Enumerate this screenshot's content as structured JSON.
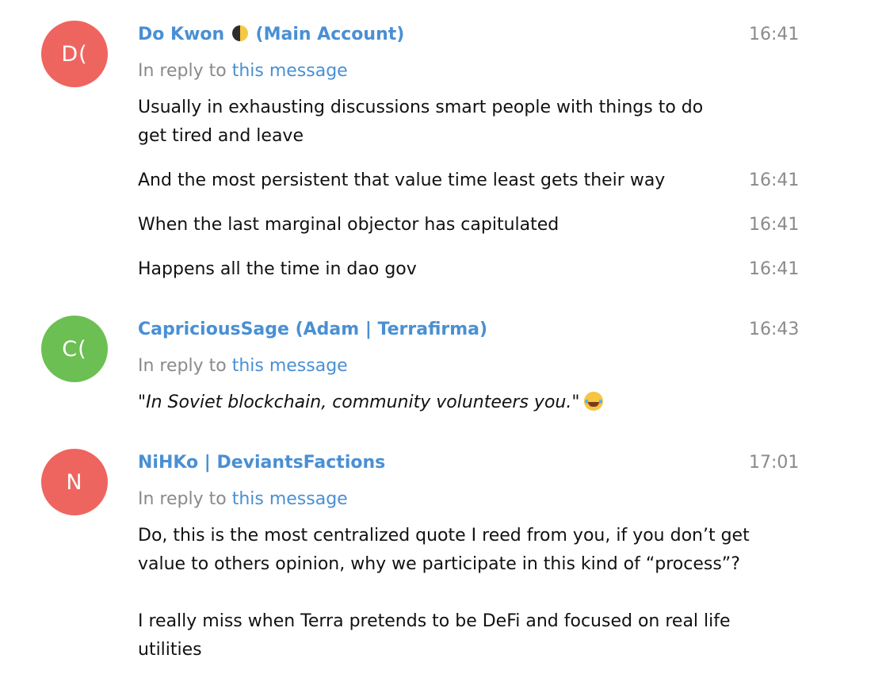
{
  "messages": [
    {
      "avatar_initials": "D(",
      "avatar_color": "#ee6560",
      "author_prefix": "Do Kwon",
      "author_icon": "moon-icon",
      "author_suffix": "(Main Account)",
      "time": "16:41",
      "reply_prefix": "In reply to",
      "reply_link": "this message",
      "lines": [
        {
          "text": "Usually in exhausting discussions smart people with things to do get tired and leave"
        },
        {
          "text": "And the most persistent that value time least gets their way",
          "time": "16:41"
        },
        {
          "text": "When the last marginal objector has capitulated",
          "time": "16:41"
        },
        {
          "text": "Happens all the time in dao gov",
          "time": "16:41"
        }
      ]
    },
    {
      "avatar_initials": "C(",
      "avatar_color": "#6cbf52",
      "author": "CapriciousSage (Adam | Terrafirma)",
      "time": "16:43",
      "reply_prefix": "In reply to",
      "reply_link": "this message",
      "quote_open": "\"",
      "quote_text": "In Soviet blockchain, community volunteers you.",
      "quote_close": "\"",
      "emoji_icon": "face-with-tears-of-joy-icon"
    },
    {
      "avatar_initials": "N",
      "avatar_color": "#ee6560",
      "author": "NiHKo | DeviantsFactions",
      "time": "17:01",
      "reply_prefix": "In reply to",
      "reply_link": "this message",
      "paragraph_1": "Do, this is the most centralized quote I reed from you, if you don’t get value to others opinion, why we participate in this kind of “process”?",
      "paragraph_2": "I really miss when Terra pretends to be DeFi and focused on real life utilities"
    }
  ]
}
